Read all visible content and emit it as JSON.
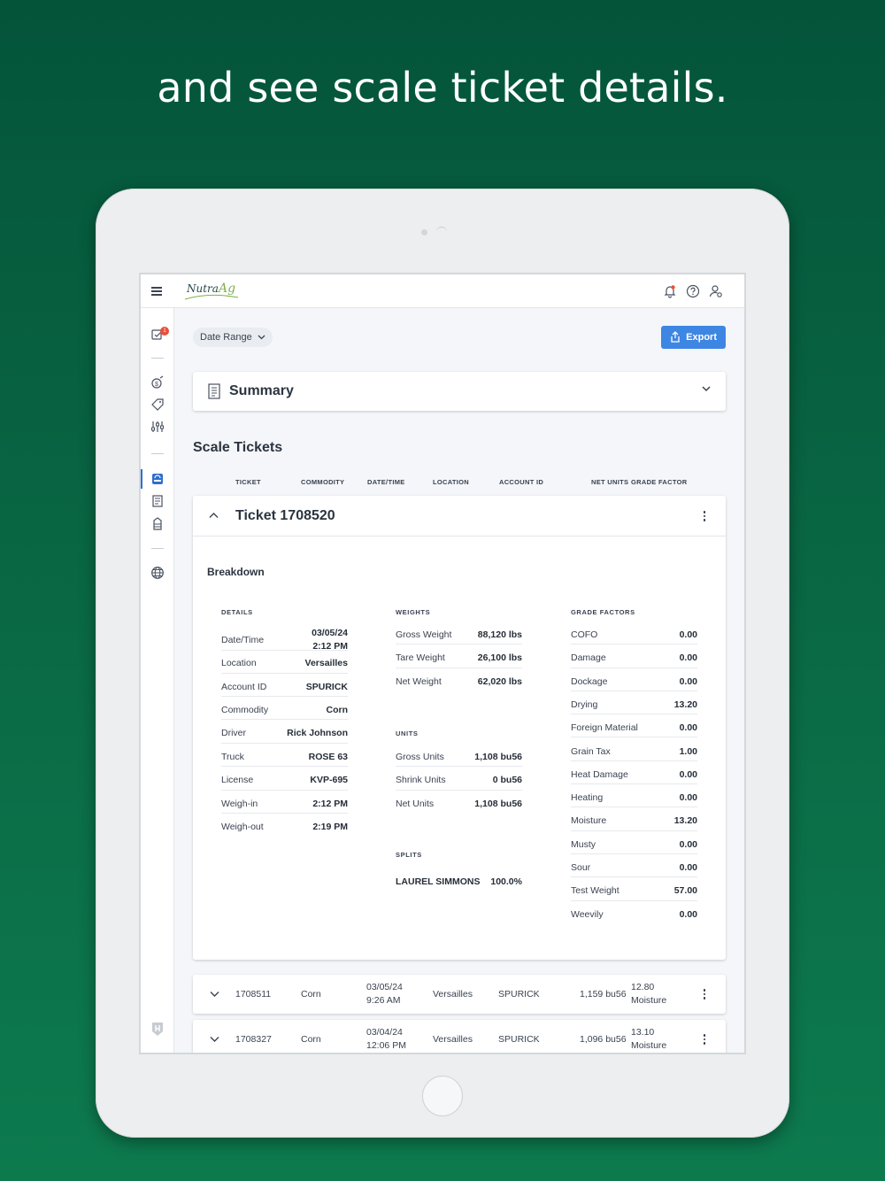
{
  "headline": "and see scale ticket details.",
  "app": {
    "logo_text": "Nutra",
    "logo_accent": "Ag",
    "accent_color": "#3e86e3",
    "background_color": "#04543a"
  },
  "topbar": {
    "icons": [
      "menu-icon",
      "bell-icon",
      "help-icon",
      "user-settings-icon"
    ]
  },
  "sidebar": {
    "notification_count": "1",
    "items": [
      "tasks-icon",
      "money-icon",
      "tag-icon",
      "sliders-icon",
      "scale-icon",
      "contracts-icon",
      "bin-icon",
      "globe-icon"
    ]
  },
  "toolbar": {
    "date_range_label": "Date Range",
    "export_label": "Export"
  },
  "summary": {
    "title": "Summary"
  },
  "scale_tickets": {
    "title": "Scale Tickets",
    "columns": [
      "TICKET",
      "COMMODITY",
      "DATE/TIME",
      "LOCATION",
      "ACCOUNT ID",
      "NET UNITS",
      "GRADE FACTOR"
    ]
  },
  "expanded_ticket": {
    "title": "Ticket 1708520",
    "breakdown_label": "Breakdown",
    "details_label": "DETAILS",
    "details": [
      {
        "k": "Date/Time",
        "v": "03/05/24",
        "v2": "2:12 PM"
      },
      {
        "k": "Location",
        "v": "Versailles"
      },
      {
        "k": "Account ID",
        "v": "SPURICK"
      },
      {
        "k": "Commodity",
        "v": "Corn"
      },
      {
        "k": "Driver",
        "v": "Rick Johnson"
      },
      {
        "k": "Truck",
        "v": "ROSE 63"
      },
      {
        "k": "License",
        "v": "KVP-695"
      },
      {
        "k": "Weigh-in",
        "v": "2:12 PM"
      },
      {
        "k": "Weigh-out",
        "v": "2:19 PM"
      }
    ],
    "weights_label": "WEIGHTS",
    "weights": [
      {
        "k": "Gross Weight",
        "v": "88,120 lbs"
      },
      {
        "k": "Tare Weight",
        "v": "26,100 lbs"
      },
      {
        "k": "Net Weight",
        "v": "62,020 lbs"
      }
    ],
    "units_label": "UNITS",
    "units": [
      {
        "k": "Gross Units",
        "v": "1,108 bu56"
      },
      {
        "k": "Shrink Units",
        "v": "0 bu56"
      },
      {
        "k": "Net Units",
        "v": "1,108 bu56"
      }
    ],
    "splits_label": "SPLITS",
    "splits": {
      "name": "LAUREL SIMMONS",
      "pct": "100.0%"
    },
    "grade_label": "GRADE FACTORS",
    "grade_factors": [
      {
        "k": "COFO",
        "v": "0.00"
      },
      {
        "k": "Damage",
        "v": "0.00"
      },
      {
        "k": "Dockage",
        "v": "0.00"
      },
      {
        "k": "Drying",
        "v": "13.20"
      },
      {
        "k": "Foreign Material",
        "v": "0.00"
      },
      {
        "k": "Grain Tax",
        "v": "1.00"
      },
      {
        "k": "Heat Damage",
        "v": "0.00"
      },
      {
        "k": "Heating",
        "v": "0.00"
      },
      {
        "k": "Moisture",
        "v": "13.20"
      },
      {
        "k": "Musty",
        "v": "0.00"
      },
      {
        "k": "Sour",
        "v": "0.00"
      },
      {
        "k": "Test Weight",
        "v": "57.00"
      },
      {
        "k": "Weevily",
        "v": "0.00"
      }
    ]
  },
  "ticket_rows": [
    {
      "ticket": "1708511",
      "commodity": "Corn",
      "date": "03/05/24",
      "time": "9:26 AM",
      "location": "Versailles",
      "account": "SPURICK",
      "net_units": "1,159 bu56",
      "grade_value": "12.80",
      "grade_name": "Moisture"
    },
    {
      "ticket": "1708327",
      "commodity": "Corn",
      "date": "03/04/24",
      "time": "12:06 PM",
      "location": "Versailles",
      "account": "SPURICK",
      "net_units": "1,096 bu56",
      "grade_value": "13.10",
      "grade_name": "Moisture"
    }
  ]
}
